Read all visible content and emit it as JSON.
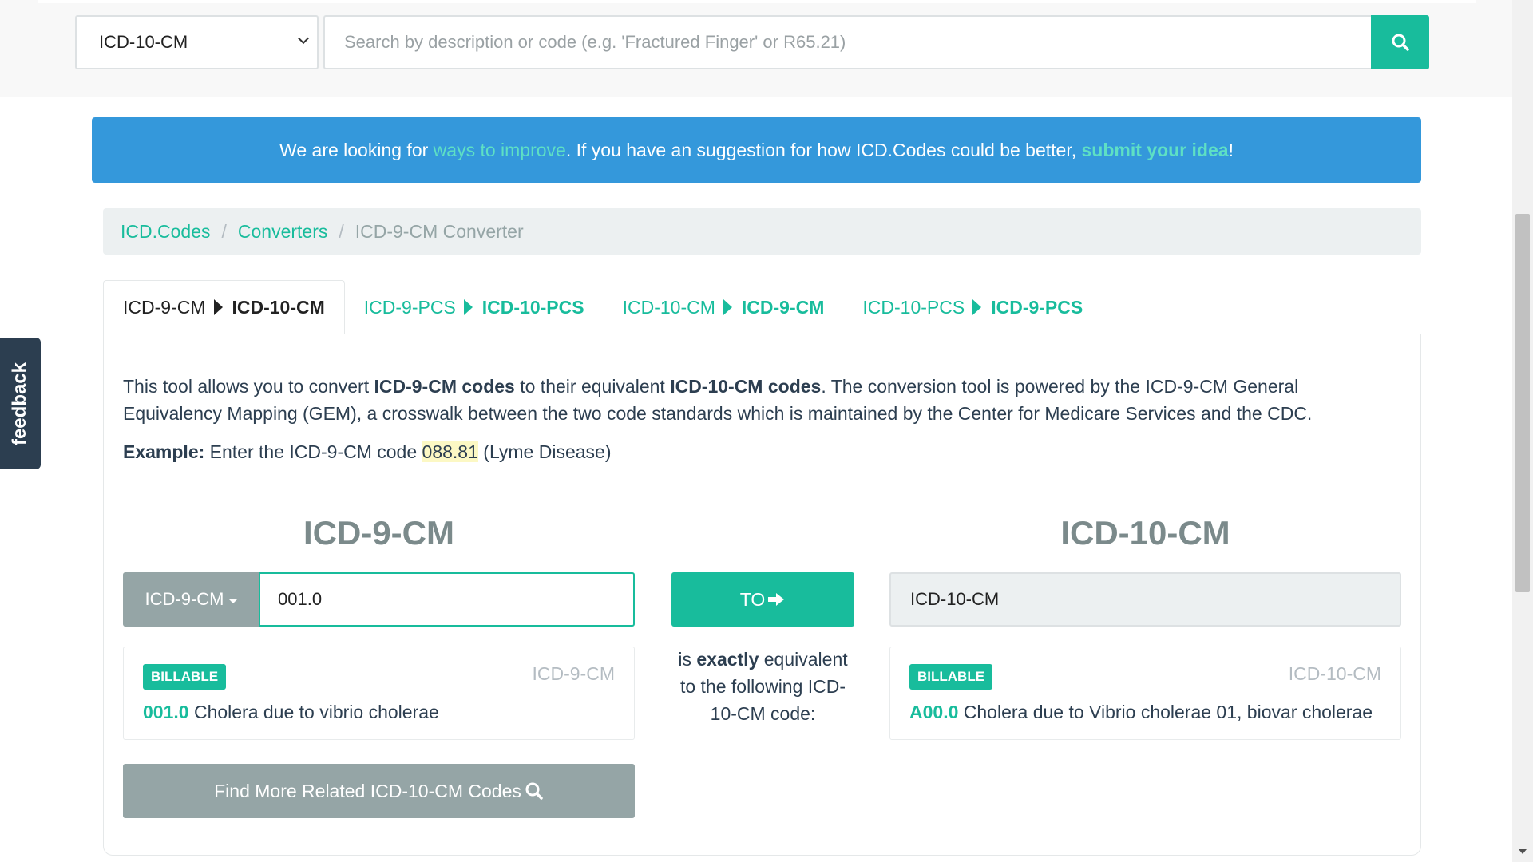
{
  "top_search": {
    "code_set_value": "ICD-10-CM",
    "placeholder": "Search by description or code (e.g. 'Fractured Finger' or R65.21)"
  },
  "announcement": {
    "part1": "We are looking for ",
    "link1": "ways to improve",
    "part2": ". If you have an suggestion for how ICD.Codes could be better, ",
    "link2": "submit your idea",
    "part3": "!"
  },
  "breadcrumb": {
    "items": [
      "ICD.Codes",
      "Converters"
    ],
    "sep": "/",
    "current": "ICD-9-CM Converter"
  },
  "tabs": [
    {
      "from": "ICD-9-CM",
      "to": "ICD-10-CM"
    },
    {
      "from": "ICD-9-PCS",
      "to": "ICD-10-PCS"
    },
    {
      "from": "ICD-10-CM",
      "to": "ICD-9-CM"
    },
    {
      "from": "ICD-10-PCS",
      "to": "ICD-9-PCS"
    }
  ],
  "description": {
    "t1": "This tool allows you to convert ",
    "b1": "ICD-9-CM codes",
    "t2": " to their equivalent ",
    "b2": "ICD-10-CM codes",
    "t3": ". The conversion tool is powered by the ICD-9-CM General Equivalency Mapping (GEM), a crosswalk between the two code standards which is maintained by the Center for Medicare Services and the CDC."
  },
  "example": {
    "label": "Example:",
    "t1": " Enter the ICD-9-CM code ",
    "code": "088.81",
    "t2": " (Lyme Disease)"
  },
  "converter": {
    "from_title": "ICD-9-CM",
    "to_title": "ICD-10-CM",
    "from_dropdown": "ICD-9-CM",
    "from_value": "001.0",
    "to_button": "TO",
    "to_placeholder": "ICD-10-CM",
    "mid_t1": "is ",
    "mid_b": "exactly",
    "mid_t2": " equivalent to the following ICD-10-CM code:",
    "from_result": {
      "badge": "BILLABLE",
      "standard": "ICD-9-CM",
      "code": "001.0",
      "desc": " Cholera due to vibrio cholerae"
    },
    "to_result": {
      "badge": "BILLABLE",
      "standard": "ICD-10-CM",
      "code": "A00.0",
      "desc": " Cholera due to Vibrio cholerae 01, biovar cholerae"
    },
    "more_button": "Find More Related ICD-10-CM Codes"
  },
  "feedback": "feedback",
  "colors": {
    "accent": "#18bc9c",
    "primary": "#2c3e50",
    "info": "#3498db",
    "muted": "#95a5a6"
  }
}
